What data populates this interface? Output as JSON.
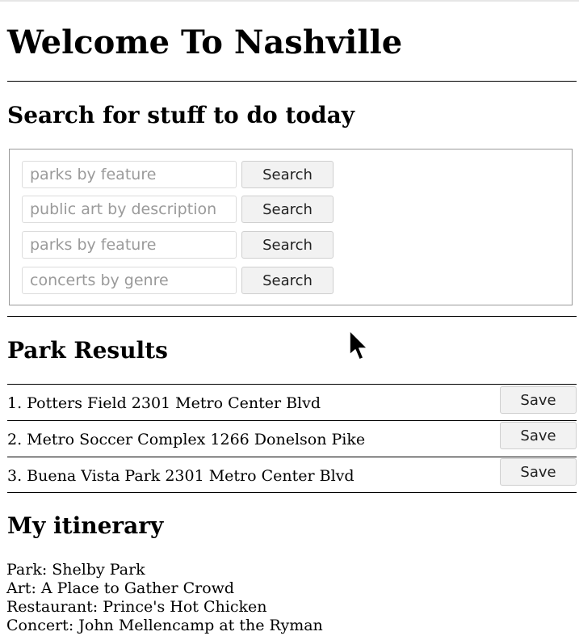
{
  "page": {
    "title": "Welcome To Nashville"
  },
  "search": {
    "heading": "Search for stuff to do today",
    "rows": [
      {
        "placeholder": "parks by feature",
        "button_label": "Search"
      },
      {
        "placeholder": "public art by description",
        "button_label": "Search"
      },
      {
        "placeholder": "parks by feature",
        "button_label": "Search"
      },
      {
        "placeholder": "concerts by genre",
        "button_label": "Search"
      }
    ]
  },
  "results": {
    "heading": "Park Results",
    "items": [
      {
        "text": "1. Potters Field 2301 Metro Center Blvd",
        "button_label": "Save"
      },
      {
        "text": "2. Metro Soccer Complex 1266 Donelson Pike",
        "button_label": "Save"
      },
      {
        "text": "3. Buena Vista Park 2301 Metro Center Blvd",
        "button_label": "Save"
      }
    ]
  },
  "itinerary": {
    "heading": "My itinerary",
    "lines": [
      "Park: Shelby Park",
      "Art: A Place to Gather Crowd",
      "Restaurant: Prince's Hot Chicken",
      "Concert: John Mellencamp at the Ryman"
    ]
  },
  "icons": {
    "cursor": "mouse-pointer-icon"
  }
}
